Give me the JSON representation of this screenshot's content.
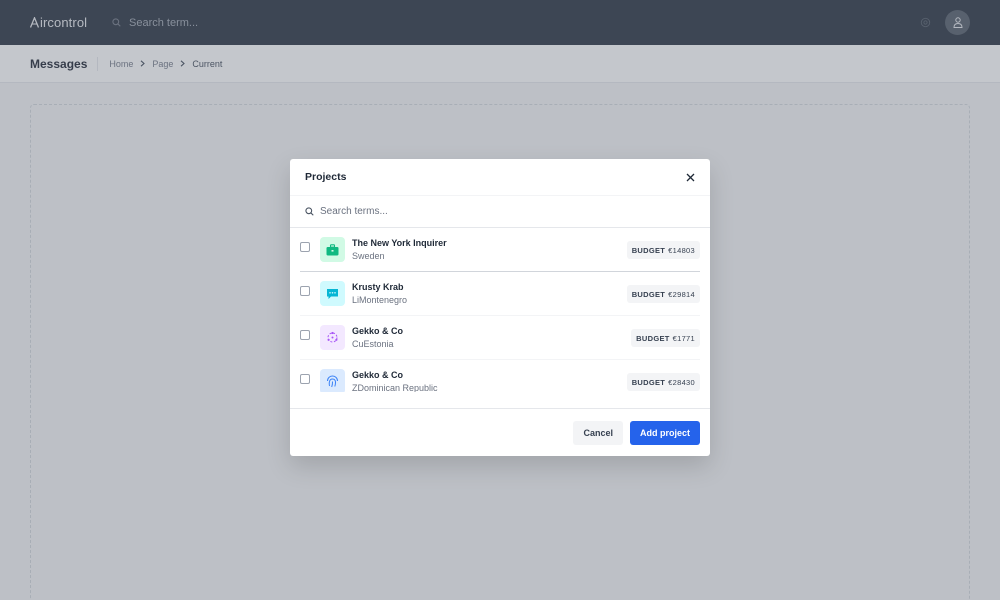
{
  "app": {
    "logo_text": "ircontrol",
    "search_placeholder": "Search term..."
  },
  "subheader": {
    "title": "Messages",
    "breadcrumb": [
      "Home",
      "Page",
      "Current"
    ]
  },
  "modal": {
    "title": "Projects",
    "search_placeholder": "Search terms...",
    "items": [
      {
        "name": "The New York Inquirer",
        "sub": "Sweden",
        "badge_label": "BUDGET",
        "badge_value": "€14803",
        "icon": "briefcase-icon",
        "icon_color": "#10b981",
        "icon_bg": "#d1fae5"
      },
      {
        "name": "Krusty Krab",
        "sub": "LiMontenegro",
        "badge_label": "BUDGET",
        "badge_value": "€29814",
        "icon": "chat-bubble-icon",
        "icon_color": "#06b6d4",
        "icon_bg": "#cffafe"
      },
      {
        "name": "Gekko & Co",
        "sub": "CuEstonia",
        "badge_label": "BUDGET",
        "badge_value": "€1771",
        "icon": "atom-icon",
        "icon_color": "#a855f7",
        "icon_bg": "#f3e8ff"
      },
      {
        "name": "Gekko & Co",
        "sub": "ZDominican Republic",
        "badge_label": "BUDGET",
        "badge_value": "€28430",
        "icon": "fingerprint-icon",
        "icon_color": "#3b82f6",
        "icon_bg": "#dbeafe"
      }
    ],
    "cancel_label": "Cancel",
    "add_label": "Add project"
  }
}
